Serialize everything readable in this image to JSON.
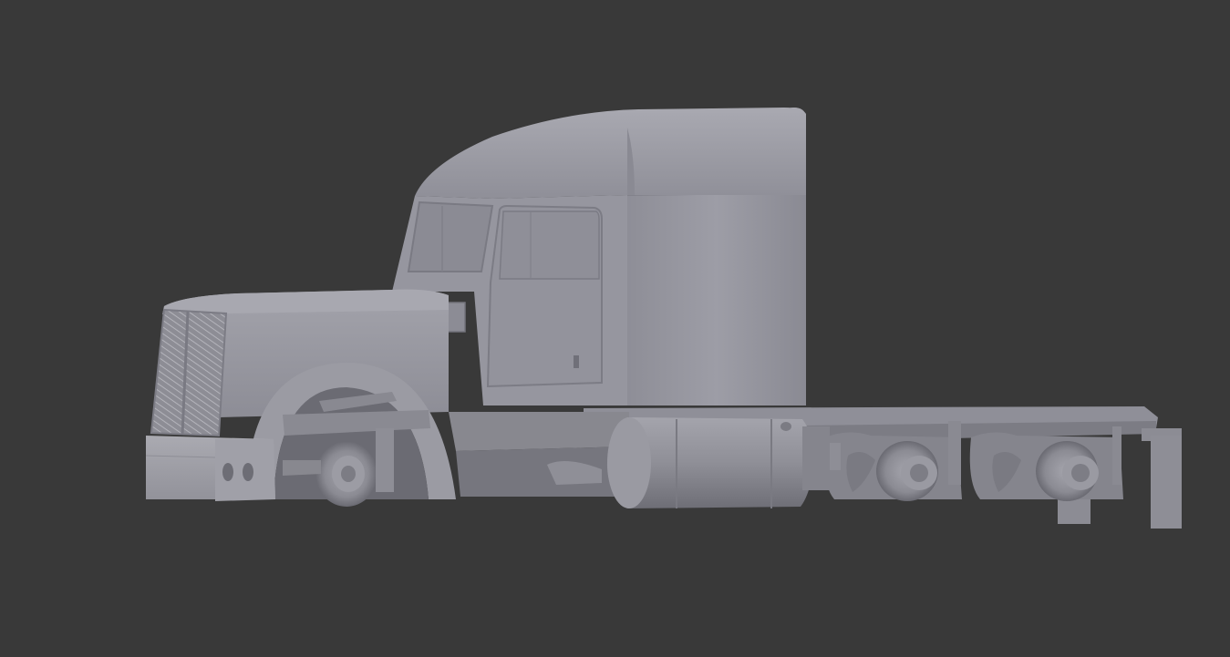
{
  "viewport": {
    "background_color": "#393939",
    "model_base_color": "#9b9ba3",
    "model_shadow_color": "#6f6f76",
    "model_highlight_color": "#c4c4cb",
    "shading_mode": "solid"
  },
  "model": {
    "subject": "semi-truck-tractor"
  }
}
